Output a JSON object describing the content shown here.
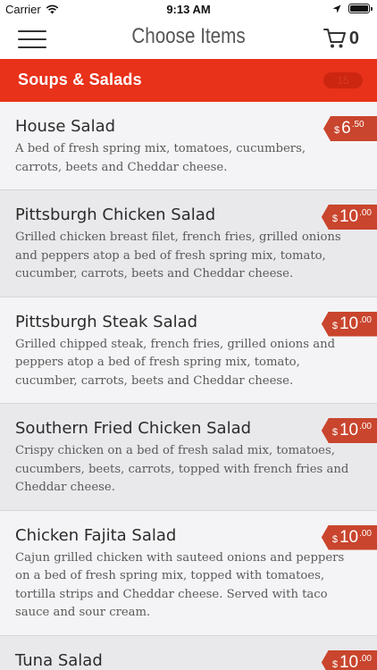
{
  "status_bar": {
    "carrier": "Carrier",
    "time": "9:13 AM",
    "battery_level": 1.0
  },
  "nav": {
    "title": "Choose Items",
    "cart_count": "0"
  },
  "category": {
    "title": "Soups & Salads",
    "item_count": "15"
  },
  "colors": {
    "accent": "#e8321a",
    "price_tag": "#c9452d"
  },
  "items": [
    {
      "name": "House Salad",
      "desc": "A bed of fresh spring mix, tomatoes, cucumbers, carrots, beets and Cheddar cheese.",
      "price": {
        "currency": "$",
        "dollars": "6",
        "cents": ".50"
      }
    },
    {
      "name": "Pittsburgh Chicken Salad",
      "desc": "Grilled chicken breast filet, french fries, grilled onions and peppers atop a bed of fresh spring mix, tomato, cucumber, carrots, beets and Cheddar cheese.",
      "price": {
        "currency": "$",
        "dollars": "10",
        "cents": ".00"
      }
    },
    {
      "name": "Pittsburgh Steak Salad",
      "desc": "Grilled chipped steak, french fries, grilled onions and peppers atop a bed of fresh spring mix, tomato, cucumber, carrots, beets and Cheddar cheese.",
      "price": {
        "currency": "$",
        "dollars": "10",
        "cents": ".00"
      }
    },
    {
      "name": "Southern Fried Chicken Salad",
      "desc": "Crispy chicken on a bed of fresh salad mix, tomatoes, cucumbers, beets, carrots, topped with french fries and Cheddar cheese.",
      "price": {
        "currency": "$",
        "dollars": "10",
        "cents": ".00"
      }
    },
    {
      "name": "Chicken Fajita Salad",
      "desc": "Cajun grilled chicken with sauteed onions and peppers on a bed of fresh spring mix, topped with tomatoes, tortilla strips and Cheddar cheese. Served with taco sauce and sour cream.",
      "price": {
        "currency": "$",
        "dollars": "10",
        "cents": ".00"
      }
    },
    {
      "name": "Tuna Salad",
      "desc": "",
      "price": {
        "currency": "$",
        "dollars": "10",
        "cents": ".00"
      }
    }
  ]
}
